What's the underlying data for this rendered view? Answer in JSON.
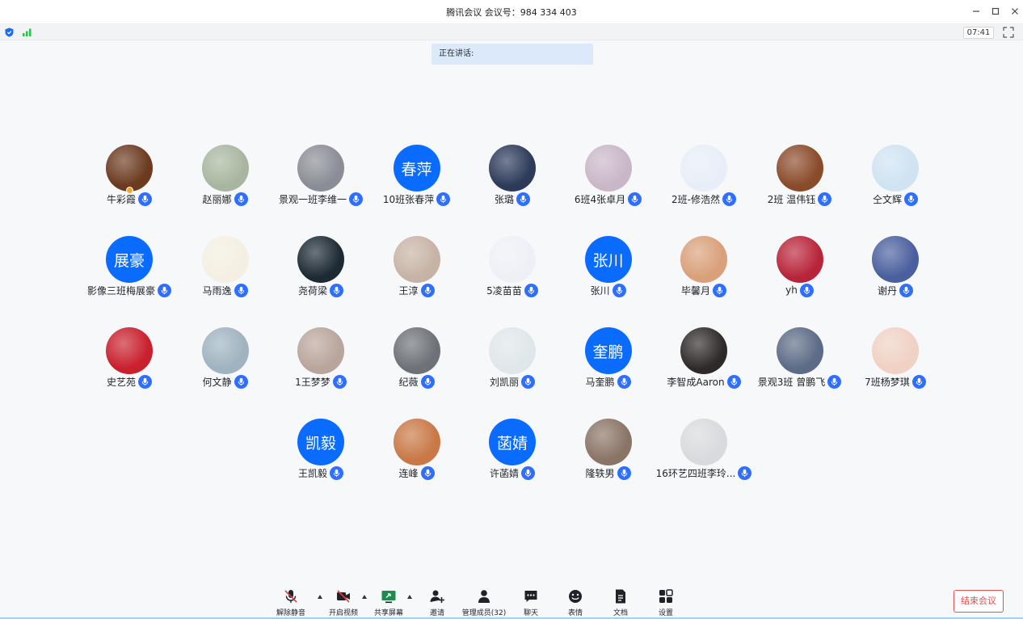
{
  "window": {
    "title": "腾讯会议 会议号：984 334 403",
    "minimize_icon": "minimize-icon",
    "maximize_icon": "maximize-icon",
    "close_icon": "close-icon"
  },
  "status": {
    "timer": "07:41",
    "shield_icon": "shield-icon",
    "signal_icon": "signal-icon"
  },
  "speaking": {
    "label": "正在讲话:"
  },
  "colors": {
    "accent": "#0a6cff",
    "mic": "#2f6fff",
    "end": "#ea4d4d"
  },
  "participants": [
    {
      "name": "牛彩霞",
      "avatar_text": "",
      "tone": "#6b3a1f"
    },
    {
      "name": "赵丽娜",
      "avatar_text": "",
      "tone": "#a8b6a0"
    },
    {
      "name": "景观一班李维一",
      "avatar_text": "",
      "tone": "#8a8d95"
    },
    {
      "name": "10班张春萍",
      "avatar_text": "春萍",
      "tone": "#0a6cff"
    },
    {
      "name": "张璐",
      "avatar_text": "",
      "tone": "#2d3a5a"
    },
    {
      "name": "6班4张卓月",
      "avatar_text": "",
      "tone": "#c9b7c7"
    },
    {
      "name": "2班-修浩然",
      "avatar_text": "",
      "tone": "#e8eef7"
    },
    {
      "name": "2班 温伟钰",
      "avatar_text": "",
      "tone": "#8a4b2a"
    },
    {
      "name": "仝文辉",
      "avatar_text": "",
      "tone": "#cfe3f2"
    },
    {
      "name": "影像三班梅展豪",
      "avatar_text": "展豪",
      "tone": "#0a6cff"
    },
    {
      "name": "马雨逸",
      "avatar_text": "",
      "tone": "#f4efe2"
    },
    {
      "name": "尧荷梁",
      "avatar_text": "",
      "tone": "#1d2a33"
    },
    {
      "name": "王淳",
      "avatar_text": "",
      "tone": "#c7b3a5"
    },
    {
      "name": "5凌苗苗",
      "avatar_text": "",
      "tone": "#eef0f6"
    },
    {
      "name": "张川",
      "avatar_text": "张川",
      "tone": "#0a6cff"
    },
    {
      "name": "毕馨月",
      "avatar_text": "",
      "tone": "#d9a07a"
    },
    {
      "name": "yh",
      "avatar_text": "",
      "tone": "#b8253a"
    },
    {
      "name": "谢丹",
      "avatar_text": "",
      "tone": "#4a5f9e"
    },
    {
      "name": "史艺苑",
      "avatar_text": "",
      "tone": "#c8202c"
    },
    {
      "name": "何文静",
      "avatar_text": "",
      "tone": "#9fb3c0"
    },
    {
      "name": "1王梦梦",
      "avatar_text": "",
      "tone": "#b9a59c"
    },
    {
      "name": "纪薇",
      "avatar_text": "",
      "tone": "#6d7178"
    },
    {
      "name": "刘凯丽",
      "avatar_text": "",
      "tone": "#dfe7ea"
    },
    {
      "name": "马奎鹏",
      "avatar_text": "奎鹏",
      "tone": "#0a6cff"
    },
    {
      "name": "李智成Aaron",
      "avatar_text": "",
      "tone": "#2f2a2a"
    },
    {
      "name": "景观3班 曾鹏飞",
      "avatar_text": "",
      "tone": "#5c6b86"
    },
    {
      "name": "7班杨梦琪",
      "avatar_text": "",
      "tone": "#f0d1c4"
    },
    {
      "name": "王凯毅",
      "avatar_text": "凯毅",
      "tone": "#0a6cff"
    },
    {
      "name": "连峰",
      "avatar_text": "",
      "tone": "#c97846"
    },
    {
      "name": "许菡婧",
      "avatar_text": "菡婧",
      "tone": "#0a6cff"
    },
    {
      "name": "隆轶男",
      "avatar_text": "",
      "tone": "#8a7466"
    },
    {
      "name": "16环艺四班李玲...",
      "avatar_text": "",
      "tone": "#d9dadd"
    }
  ],
  "toolbar": {
    "unmute": "解除静音",
    "video": "开启视频",
    "share": "共享屏幕",
    "invite": "邀请",
    "members": "管理成员(32)",
    "chat": "聊天",
    "emoji": "表情",
    "docs": "文档",
    "settings": "设置",
    "end": "结束会议"
  }
}
